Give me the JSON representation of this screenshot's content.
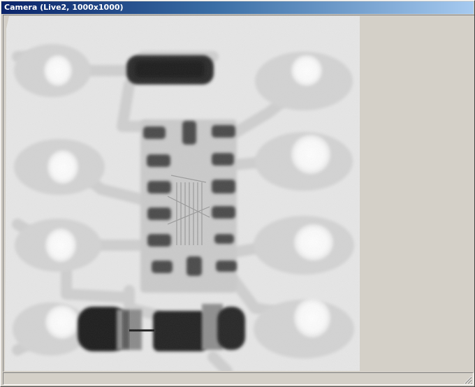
{
  "window": {
    "title": "Camera (Live2, 1000x1000)"
  },
  "image": {
    "subject": "x-ray-of-circuit-board"
  },
  "colors": {
    "title_start": "#0a246a",
    "title_end": "#a6caf0",
    "chrome": "#d4d0c8"
  },
  "statusbar": {
    "text": ""
  }
}
